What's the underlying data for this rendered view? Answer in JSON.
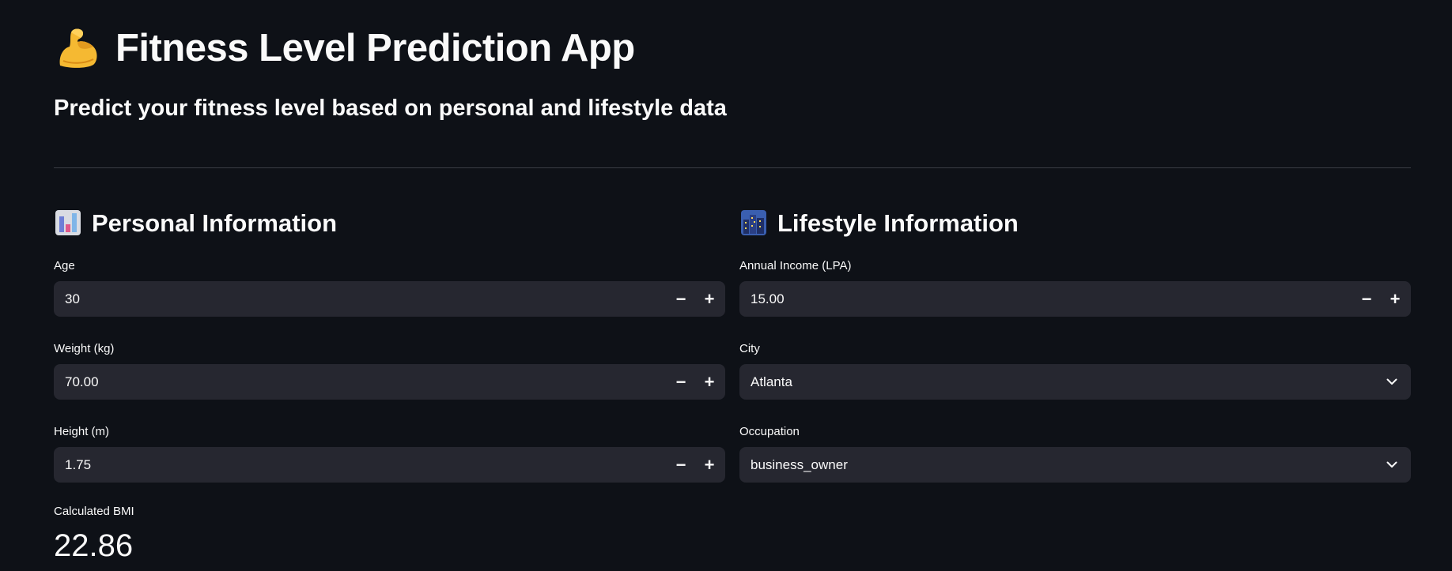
{
  "header": {
    "title": "Fitness Level Prediction App",
    "title_icon": "flexed-biceps-icon",
    "subtitle": "Predict your fitness level based on personal and lifestyle data"
  },
  "personal": {
    "heading": "Personal Information",
    "heading_icon": "bar-chart-icon",
    "age": {
      "label": "Age",
      "value": "30"
    },
    "weight": {
      "label": "Weight (kg)",
      "value": "70.00"
    },
    "height": {
      "label": "Height (m)",
      "value": "1.75"
    },
    "bmi": {
      "label": "Calculated BMI",
      "value": "22.86"
    }
  },
  "lifestyle": {
    "heading": "Lifestyle Information",
    "heading_icon": "cityscape-icon",
    "income": {
      "label": "Annual Income (LPA)",
      "value": "15.00"
    },
    "city": {
      "label": "City",
      "value": "Atlanta"
    },
    "occupation": {
      "label": "Occupation",
      "value": "business_owner"
    }
  },
  "stepper": {
    "minus": "−",
    "plus": "+"
  },
  "colors": {
    "background": "#0e1117",
    "input_bg": "#262730",
    "text": "#fafafa",
    "divider": "#3a3d45"
  }
}
